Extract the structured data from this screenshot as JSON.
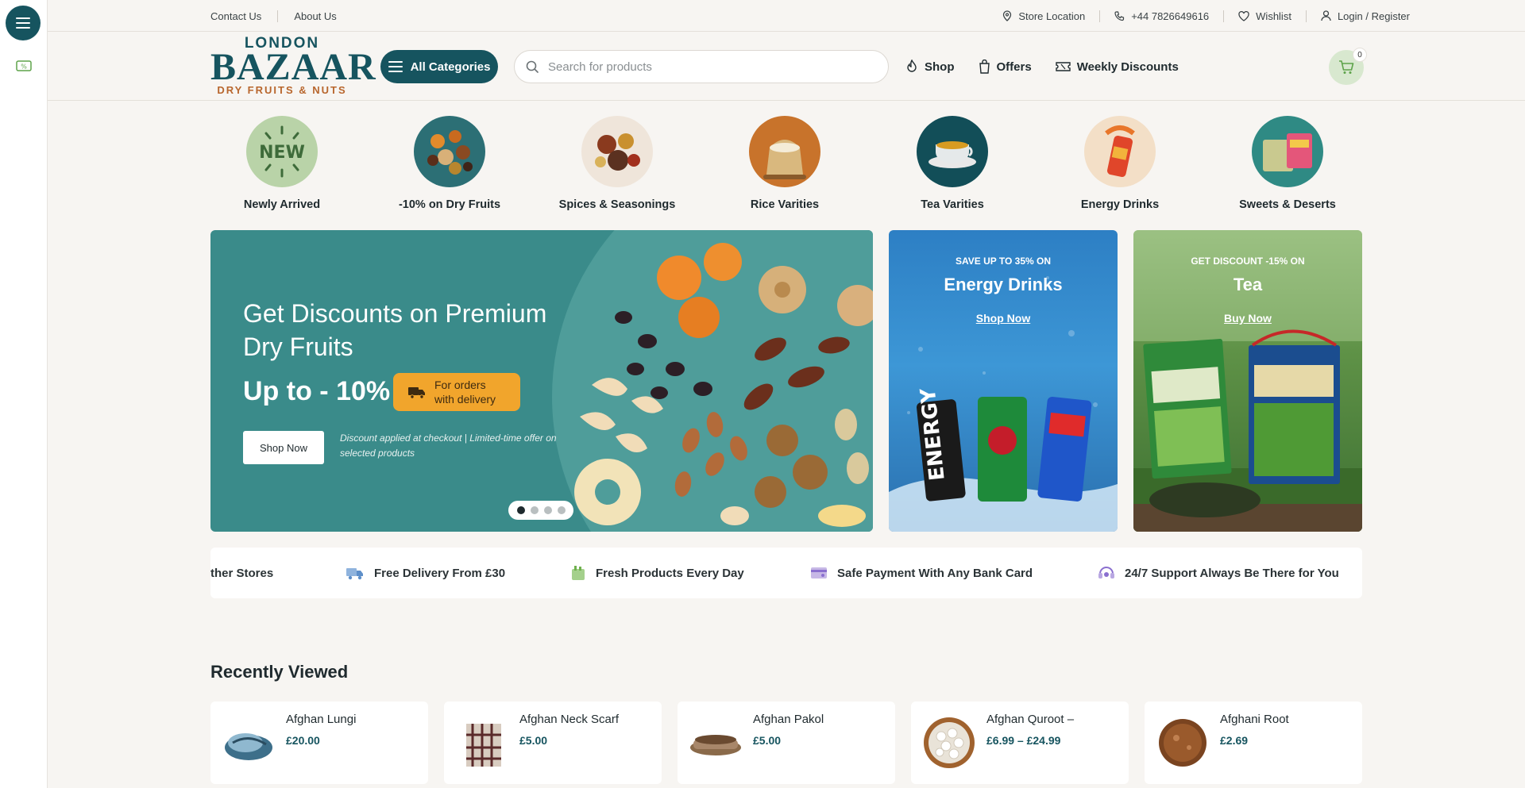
{
  "topbar": {
    "left_links": [
      "Contact Us",
      "About Us"
    ],
    "store_location": "Store Location",
    "phone": "+44 7826649616",
    "wishlist": "Wishlist",
    "login": "Login / Register"
  },
  "logo": {
    "line1": "LONDON",
    "line2": "BAZAAR",
    "line3": "DRY FRUITS & NUTS"
  },
  "header": {
    "all_categories": "All Categories",
    "search_placeholder": "Search for products",
    "nav": [
      "Shop",
      "Offers",
      "Weekly Discounts"
    ],
    "cart_count": "0"
  },
  "categories": [
    {
      "label": "Newly Arrived",
      "badge": "NEW"
    },
    {
      "label": "-10% on Dry Fruits"
    },
    {
      "label": "Spices & Seasonings"
    },
    {
      "label": "Rice Varities"
    },
    {
      "label": "Tea Varities"
    },
    {
      "label": "Energy Drinks"
    },
    {
      "label": "Sweets & Deserts"
    }
  ],
  "hero": {
    "title": "Get Discounts on Premium Dry Fruits",
    "upto": "Up to - 10%",
    "badge_line1": "For orders",
    "badge_line2": "with delivery",
    "cta": "Shop Now",
    "note": "Discount applied at checkout | Limited-time offer on selected products",
    "slides": 4,
    "active_slide": 1
  },
  "promos": [
    {
      "kicker": "SAVE UP TO 35% ON",
      "title": "Energy Drinks",
      "link": "Shop Now"
    },
    {
      "kicker": "GET DISCOUNT -15% ON",
      "title": "Tea",
      "link": "Buy Now"
    }
  ],
  "features": [
    "ther Stores",
    "Free Delivery From £30",
    "Fresh Products Every Day",
    "Safe Payment With Any Bank Card",
    "24/7 Support Always Be There for You"
  ],
  "recently_viewed": {
    "title": "Recently Viewed",
    "items": [
      {
        "name": "Afghan Lungi",
        "price": "£20.00"
      },
      {
        "name": "Afghan Neck Scarf",
        "price": "£5.00"
      },
      {
        "name": "Afghan Pakol",
        "price": "£5.00"
      },
      {
        "name": "Afghan Quroot –",
        "price": "£6.99 – £24.99"
      },
      {
        "name": "Afghani Root",
        "price": "£2.69"
      }
    ]
  },
  "colors": {
    "brand": "#16545f",
    "accent": "#b8662d",
    "hero_bg": "#3a8b8a",
    "badge": "#f1a52c"
  }
}
